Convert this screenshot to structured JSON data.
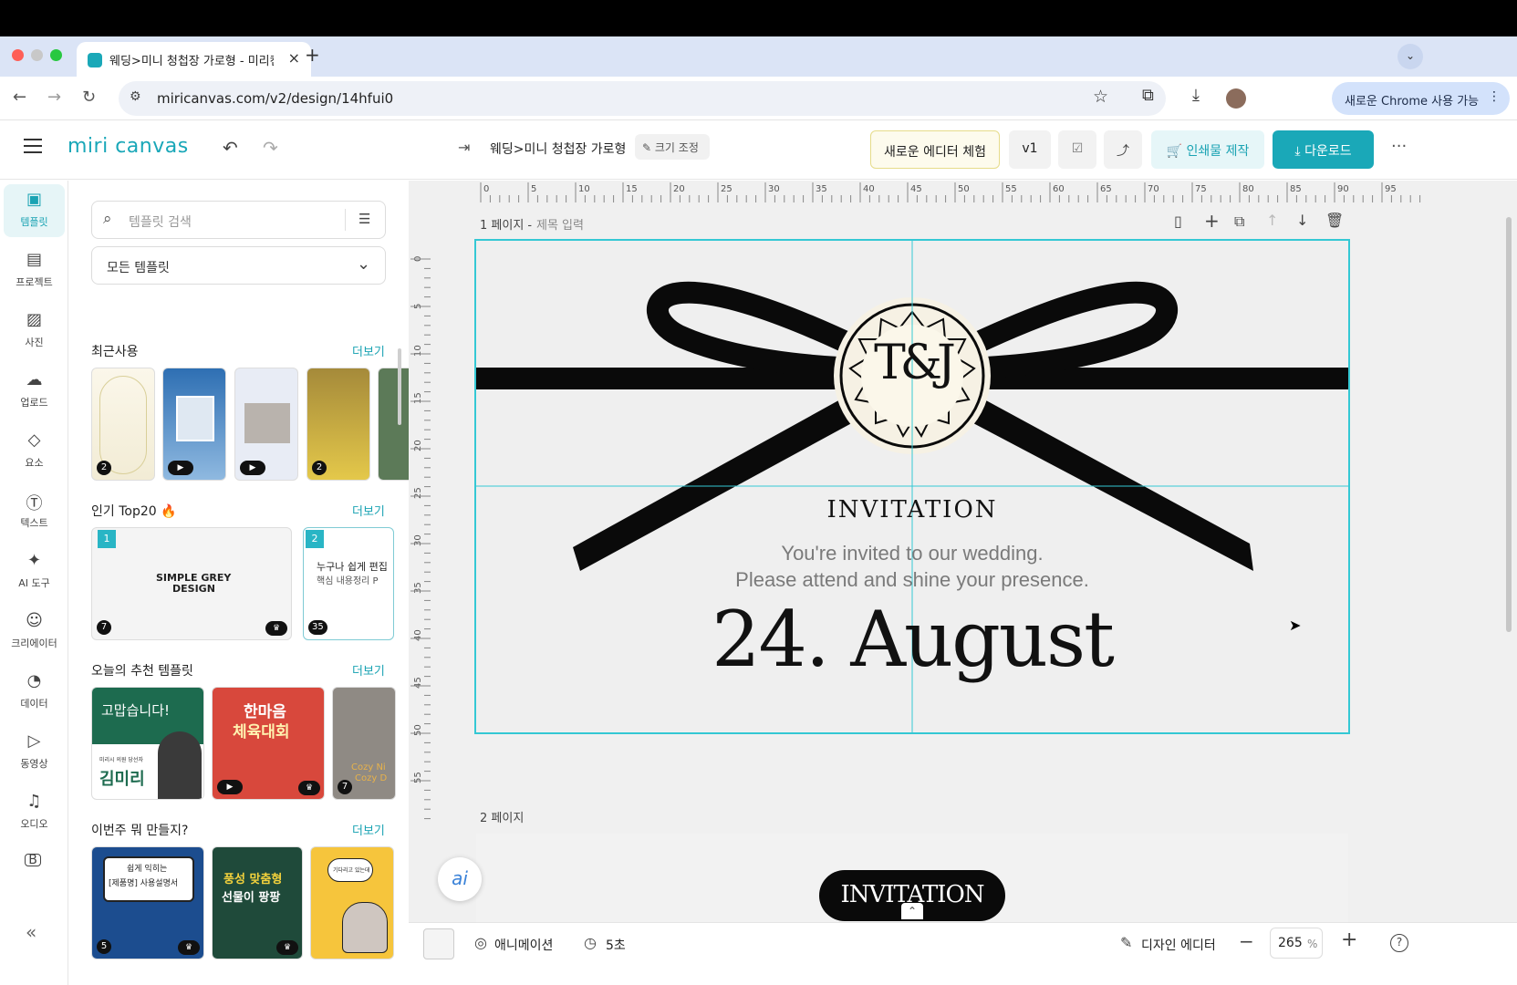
{
  "browser": {
    "tab_title": "웨딩>미니 청첩장 가로형 - 미리캔버스",
    "url": "miricanvas.com/v2/design/14hfui0",
    "chrome_pill": "새로운 Chrome 사용 가능"
  },
  "header": {
    "logo": "miri canvas",
    "doc_title": "웨딩>미니 청첩장 가로형",
    "resize_label": "크기 조정",
    "new_editor_label": "새로운 에디터 체험",
    "version_label": "v1",
    "print_label": "인쇄물 제작",
    "download_label": "다운로드"
  },
  "rail": {
    "items": [
      {
        "label": "템플릿",
        "icon": "template-icon"
      },
      {
        "label": "프로젝트",
        "icon": "project-icon"
      },
      {
        "label": "사진",
        "icon": "photo-icon"
      },
      {
        "label": "업로드",
        "icon": "upload-icon"
      },
      {
        "label": "요소",
        "icon": "elements-icon"
      },
      {
        "label": "텍스트",
        "icon": "text-icon"
      },
      {
        "label": "AI 도구",
        "icon": "ai-tools-icon"
      },
      {
        "label": "크리에이터",
        "icon": "creator-icon"
      },
      {
        "label": "데이터",
        "icon": "data-icon"
      },
      {
        "label": "동영상",
        "icon": "video-icon"
      },
      {
        "label": "오디오",
        "icon": "audio-icon"
      }
    ]
  },
  "panel": {
    "search_placeholder": "템플릿 검색",
    "category_select": "모든 템플릿",
    "more_label": "더보기",
    "sections": [
      {
        "title": "최근사용"
      },
      {
        "title": "인기 Top20 🔥"
      },
      {
        "title": "오늘의 추천 템플릿"
      },
      {
        "title": "이번주 뭐 만들지?"
      }
    ],
    "recent_badges": [
      "2",
      "",
      "",
      "2"
    ],
    "top20": [
      {
        "rank": "1",
        "text1": "SIMPLE GREY",
        "text2": "DESIGN",
        "count": "7"
      },
      {
        "rank": "2",
        "text1": "누구나 쉽게 편집",
        "text2": "핵심 내용정리 P",
        "count": "35"
      }
    ],
    "recommend": [
      {
        "text1": "고맙습니다!",
        "text2": "김미리",
        "small": "미리시 의원 당선자"
      },
      {
        "text1": "한마음",
        "text2": "체육대회"
      },
      {
        "text1": "Cozy Ni",
        "text2": "Cozy D",
        "count": "7"
      }
    ],
    "weekly": [
      {
        "text1": "쉽게 익히는",
        "text2": "[제품명] 사용설명서",
        "count": "5"
      },
      {
        "text1": "풍성 맞춤형",
        "text2": "선물이 팡팡"
      },
      {
        "text1": "기다리고 있는데"
      }
    ]
  },
  "canvas": {
    "page1_label": "1 페이지 -",
    "page1_title_placeholder": "제목 입력",
    "page2_label": "2 페이지",
    "ruler_top": [
      "0",
      "5",
      "10",
      "15",
      "20",
      "25",
      "30",
      "35",
      "40",
      "45",
      "50",
      "55",
      "60",
      "65",
      "70",
      "75",
      "80",
      "85",
      "90",
      "95"
    ],
    "ruler_left": [
      "0",
      "5",
      "10",
      "15",
      "20",
      "25",
      "30",
      "35",
      "40",
      "45",
      "50",
      "55"
    ],
    "monogram": "T&J",
    "invitation": "INVITATION",
    "line1": "You're invited to our wedding.",
    "line2": "Please attend and shine your presence.",
    "date": "24. August",
    "page2_invitation": "INVITATION"
  },
  "bottom": {
    "animation_label": "애니메이션",
    "duration_label": "5초",
    "design_editor_label": "디자인 에디터",
    "zoom_value": "265",
    "zoom_unit": "%"
  },
  "colors": {
    "accent": "#1aa3b3",
    "selection": "#34c8d4",
    "download_bg": "#1aa8b8"
  }
}
